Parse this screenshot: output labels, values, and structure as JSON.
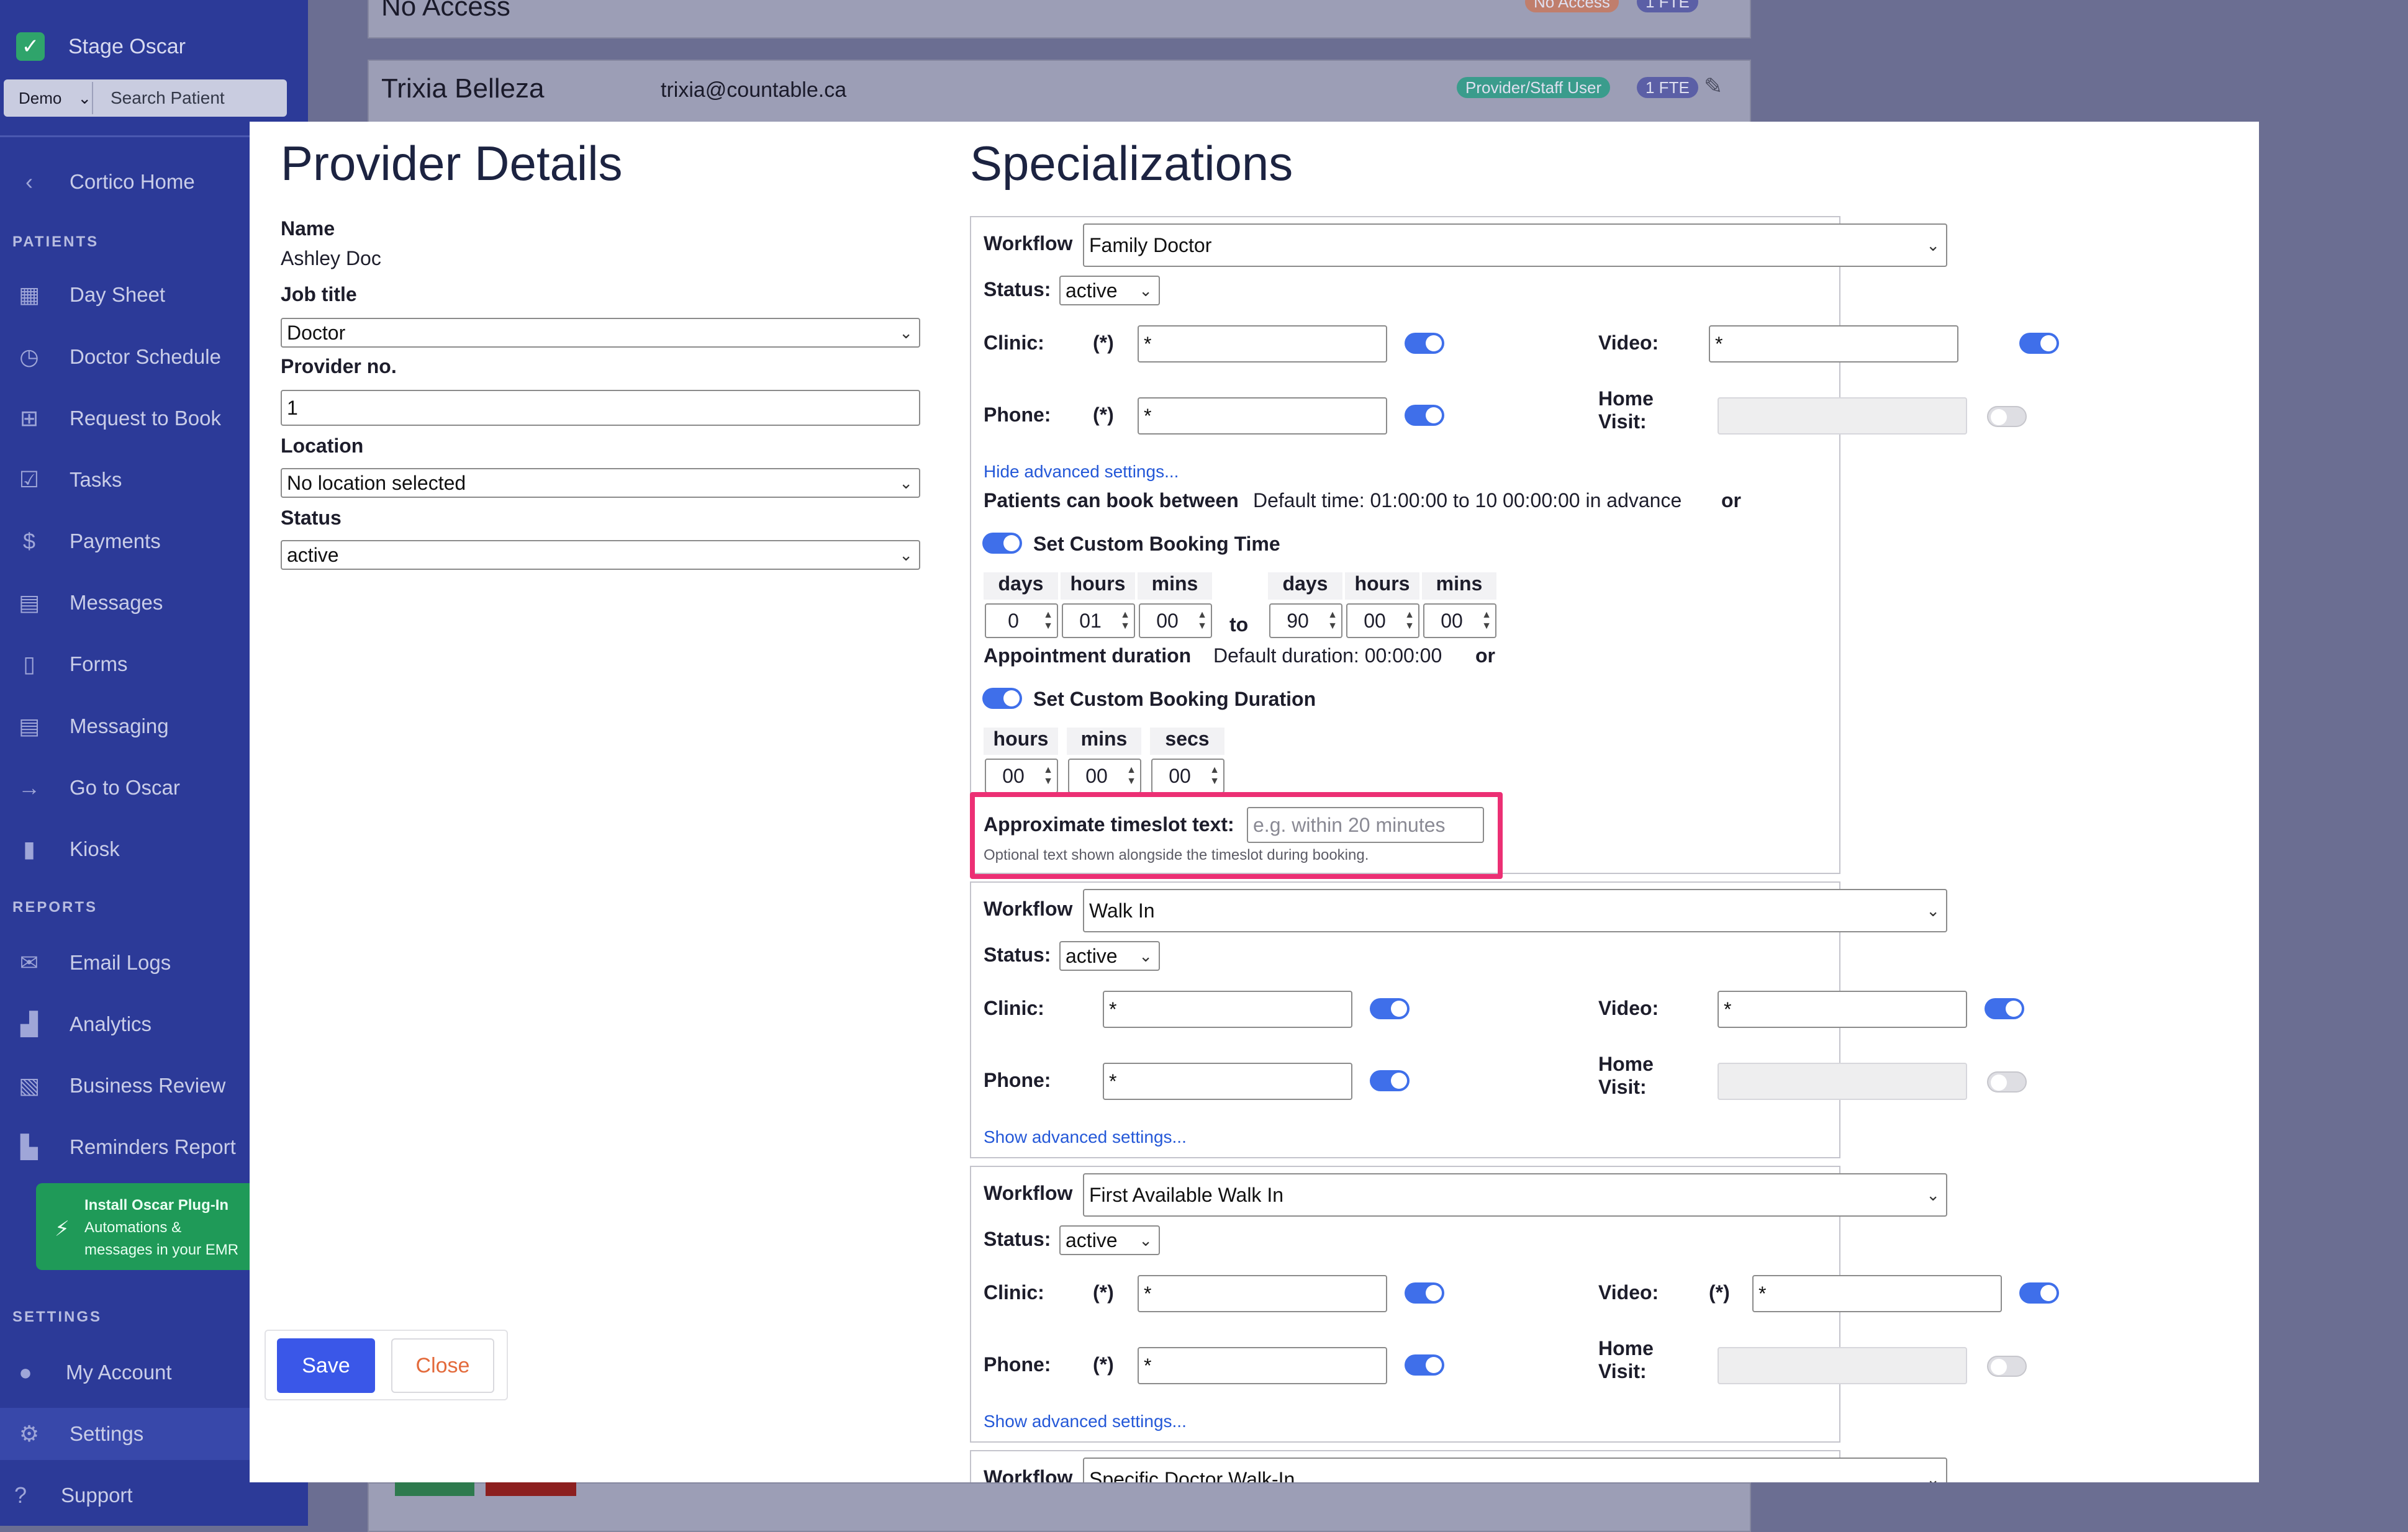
{
  "sidebar": {
    "brand": "Stage Oscar",
    "org_select": "Demo",
    "search_placeholder": "Search Patient",
    "home": "Cortico Home",
    "patients_heading": "PATIENTS",
    "patients_items": [
      {
        "label": "Day Sheet",
        "icon": "calendar-icon"
      },
      {
        "label": "Doctor Schedule",
        "icon": "clock-icon"
      },
      {
        "label": "Request to Book",
        "icon": "plus-file-icon"
      },
      {
        "label": "Tasks",
        "icon": "clipboard-check-icon"
      },
      {
        "label": "Payments",
        "icon": "dollar-icon"
      },
      {
        "label": "Messages",
        "icon": "chat-icon"
      },
      {
        "label": "Forms",
        "icon": "document-icon"
      },
      {
        "label": "Messaging",
        "icon": "chat-icon"
      },
      {
        "label": "Go to Oscar",
        "icon": "arrow-right-icon"
      },
      {
        "label": "Kiosk",
        "icon": "tablet-icon"
      }
    ],
    "reports_heading": "REPORTS",
    "reports_items": [
      {
        "label": "Email Logs",
        "icon": "envelope-icon"
      },
      {
        "label": "Analytics",
        "icon": "bar-chart-icon"
      },
      {
        "label": "Business Review",
        "icon": "report-icon"
      },
      {
        "label": "Reminders Report",
        "icon": "reminder-chart-icon"
      }
    ],
    "promo": {
      "title": "Install Oscar Plug-In",
      "line1": "Automations &",
      "line2": "messages in your EMR"
    },
    "settings_heading": "SETTINGS",
    "settings_items": [
      {
        "label": "My Account",
        "icon": "user-icon"
      },
      {
        "label": "Settings",
        "icon": "gear-icon"
      },
      {
        "label": "Support",
        "icon": "question-icon"
      }
    ]
  },
  "background": {
    "row1_name": "No Access",
    "row1_badge1": "No Access",
    "row1_badge2": "1 FTE",
    "row2_name": "Trixia Belleza",
    "row2_email": "trixia@countable.ca",
    "row2_badge1": "Provider/Staff User",
    "row2_badge2": "1 FTE"
  },
  "provider": {
    "title": "Provider Details",
    "name_label": "Name",
    "name_value": "Ashley Doc",
    "job_label": "Job title",
    "job_value": "Doctor",
    "provno_label": "Provider no.",
    "provno_value": "1",
    "location_label": "Location",
    "location_value": "No location selected",
    "status_label": "Status",
    "status_value": "active",
    "save": "Save",
    "close": "Close"
  },
  "spec": {
    "title": "Specializations",
    "workflow_label": "Workflow",
    "status_label": "Status:",
    "clinic_label": "Clinic:",
    "phone_label": "Phone:",
    "video_label": "Video:",
    "home_label_1": "Home",
    "home_label_2": "Visit:",
    "req": "(*)",
    "star": "*",
    "cards": [
      {
        "workflow": "Family Doctor",
        "status": "active",
        "advanced": "Hide advanced settings..."
      },
      {
        "workflow": "Walk In",
        "status": "active",
        "advanced": "Show advanced settings..."
      },
      {
        "workflow": "First Available Walk In",
        "status": "active",
        "advanced": "Show advanced settings..."
      },
      {
        "workflow": "Specific Doctor Walk-In"
      }
    ],
    "book_between_label": "Patients can book between",
    "book_between_default": "Default time: 01:00:00 to 10 00:00:00 in advance",
    "or": "or",
    "custom_booking_time": "Set Custom Booking Time",
    "days": "days",
    "hours": "hours",
    "mins": "mins",
    "secs": "secs",
    "to": "to",
    "from_days": "0",
    "from_hours": "01",
    "from_mins": "00",
    "to_days": "90",
    "to_hours": "00",
    "to_mins": "00",
    "duration_label": "Appointment duration",
    "duration_default": "Default duration: 00:00:00",
    "custom_duration": "Set Custom Booking Duration",
    "dur_hours": "00",
    "dur_mins": "00",
    "dur_secs": "00",
    "timeslot_label": "Approximate timeslot text:",
    "timeslot_placeholder": "e.g. within 20 minutes",
    "timeslot_help": "Optional text shown alongside the timeslot during booking."
  },
  "colors": {
    "accent": "#3f6fea",
    "sidebar": "#2c3a98",
    "highlight": "#ec2f74",
    "save": "#3a57e8"
  }
}
